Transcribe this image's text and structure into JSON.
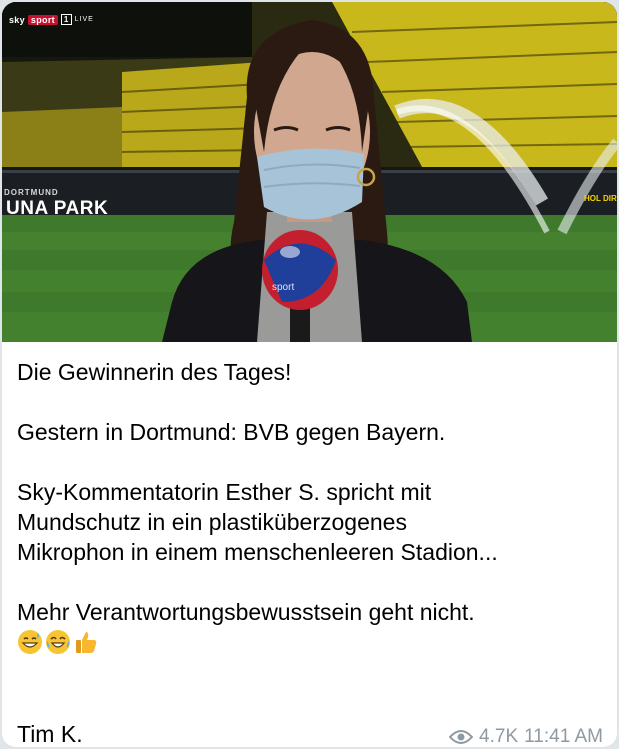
{
  "photo": {
    "broadcast_logo": {
      "brand": "sky",
      "channel": "sport",
      "number": "1",
      "live": "LIVE"
    },
    "ad_board_small": "DORTMUND",
    "ad_board_big": "UNA  PARK",
    "ad_board_right": "HOL DIR"
  },
  "message": {
    "title": "Die Gewinnerin des Tages!",
    "line2": "Gestern in Dortmund: BVB gegen Bayern.",
    "para3_line1": "Sky-Kommentatorin Esther S. spricht mit",
    "para3_line2": "Mundschutz in ein plastiküberzogenes",
    "para3_line3": "Mikrophon in einem menschenleeren Stadion...",
    "para4": "Mehr Verantwortungsbewusstsein geht nicht.",
    "emojis": [
      "grinning-face-with-sweat",
      "tears-of-joy",
      "thumbs-up"
    ],
    "signature": "Tim K."
  },
  "meta": {
    "views": "4.7K",
    "time": "11:41 AM",
    "icon": "eye-icon"
  },
  "colors": {
    "background": "#dfe5e9",
    "bubble": "#ffffff",
    "text": "#000000",
    "meta": "#8e9aa3",
    "stadium_seats": "#d6c21a",
    "pitch": "#3f7a2c"
  }
}
